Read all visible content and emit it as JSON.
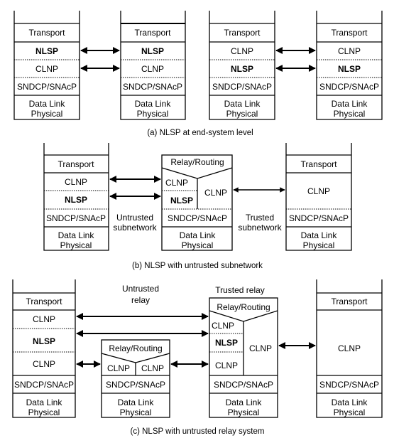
{
  "layers": {
    "transport": "Transport",
    "nlsp": "NLSP",
    "clnp": "CLNP",
    "sndcp": "SNDCP/SNAcP",
    "datalink": "Data Link",
    "physical": "Physical",
    "relay": "Relay/Routing"
  },
  "captions": {
    "a": "(a)  NLSP at end-system level",
    "b": "(b)  NLSP with untrusted subnetwork",
    "c": "(c)  NLSP with untrusted relay system"
  },
  "labels": {
    "untrusted_sub_1": "Untrusted",
    "untrusted_sub_2": "subnetwork",
    "trusted_sub_1": "Trusted",
    "trusted_sub_2": "subnetwork",
    "untrusted_relay_1": "Untrusted",
    "untrusted_relay_2": "relay",
    "trusted_relay": "Trusted relay"
  }
}
